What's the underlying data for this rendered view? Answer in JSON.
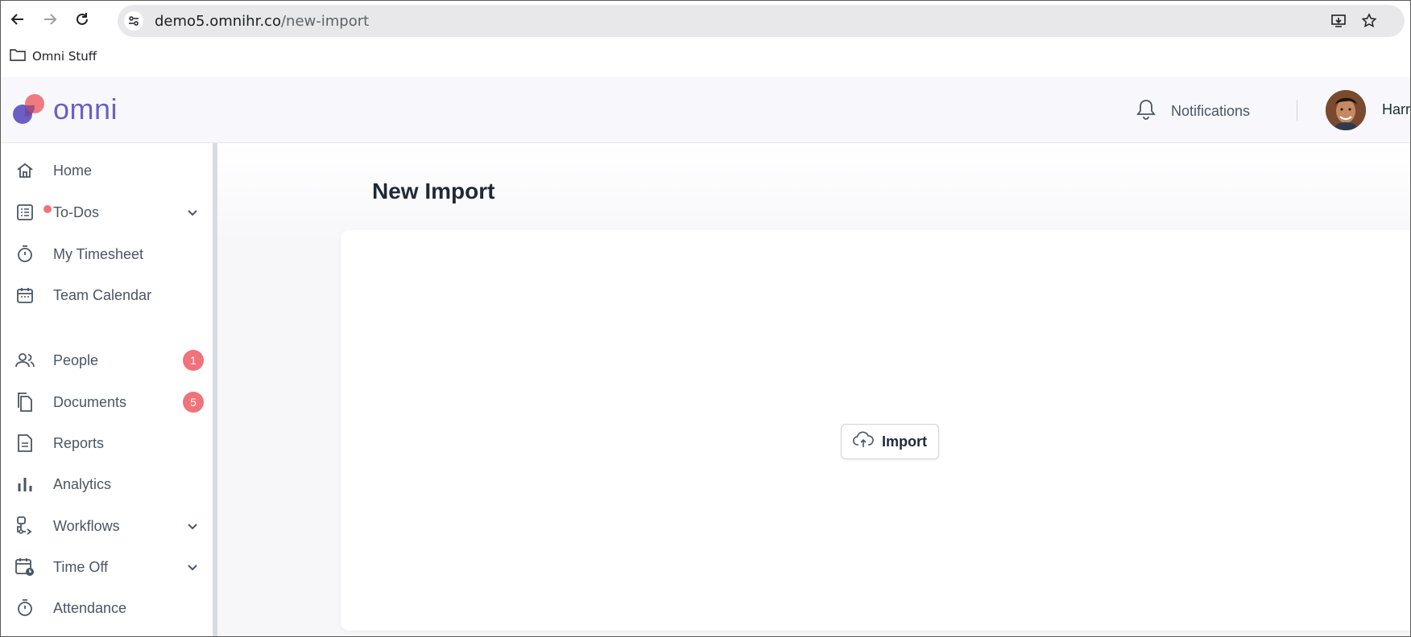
{
  "browser": {
    "url_domain": "demo5.omnihr.co",
    "url_path": "/new-import",
    "bookmark_label": "Omni Stuff",
    "icons": [
      "back-arrow-icon",
      "forward-arrow-icon",
      "reload-icon",
      "site-info-icon",
      "install-app-icon",
      "star-icon",
      "folder-icon"
    ]
  },
  "header": {
    "logo_text": "omni",
    "notifications_label": "Notifications",
    "user_name": "Harr"
  },
  "sidebar": {
    "items": [
      {
        "label": "Home",
        "icon": "home-icon"
      },
      {
        "label": "To-Dos",
        "icon": "todo-list-icon",
        "has_dot": true,
        "expandable": true
      },
      {
        "label": "My Timesheet",
        "icon": "stopwatch-icon"
      },
      {
        "label": "Team Calendar",
        "icon": "calendar-icon"
      },
      {
        "label": "People",
        "icon": "people-icon",
        "badge": "1"
      },
      {
        "label": "Documents",
        "icon": "documents-icon",
        "badge": "5"
      },
      {
        "label": "Reports",
        "icon": "report-icon"
      },
      {
        "label": "Analytics",
        "icon": "bar-chart-icon"
      },
      {
        "label": "Workflows",
        "icon": "workflow-icon",
        "expandable": true
      },
      {
        "label": "Time Off",
        "icon": "calendar-clock-icon",
        "expandable": true
      },
      {
        "label": "Attendance",
        "icon": "stopwatch-icon"
      }
    ]
  },
  "main": {
    "page_title": "New Import",
    "import_button_label": "Import"
  },
  "colors": {
    "brand_purple": "#6b5fc7",
    "brand_coral": "#f0727a",
    "badge": "#f0727a",
    "text_muted": "#4b5563"
  }
}
